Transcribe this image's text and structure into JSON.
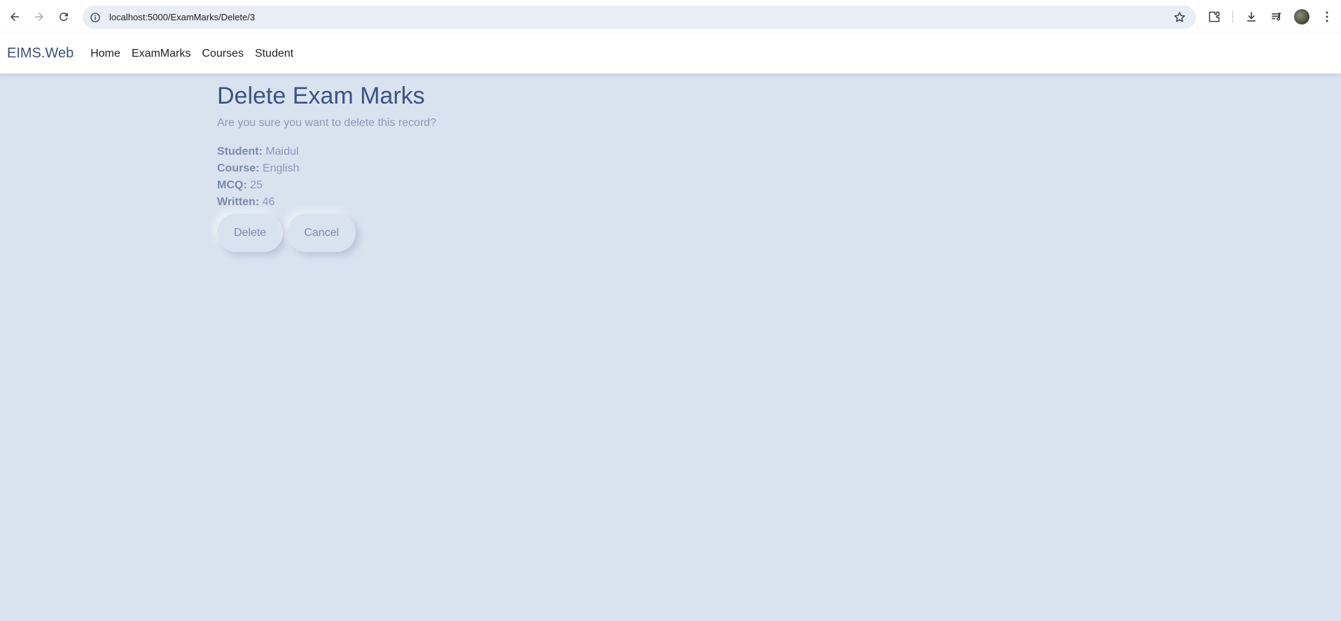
{
  "browser": {
    "url": "localhost:5000/ExamMarks/Delete/3"
  },
  "navbar": {
    "brand": "EIMS.Web",
    "links": [
      "Home",
      "ExamMarks",
      "Courses",
      "Student"
    ]
  },
  "page": {
    "title": "Delete Exam Marks",
    "subtitle": "Are you sure you want to delete this record?",
    "details": [
      {
        "label": "Student:",
        "value": "Maidul"
      },
      {
        "label": "Course:",
        "value": "English"
      },
      {
        "label": "MCQ:",
        "value": "25"
      },
      {
        "label": "Written:",
        "value": "46"
      }
    ],
    "delete_label": "Delete",
    "cancel_label": "Cancel"
  },
  "colors": {
    "background": "#d9e3f0",
    "accent": "#3d5283"
  }
}
